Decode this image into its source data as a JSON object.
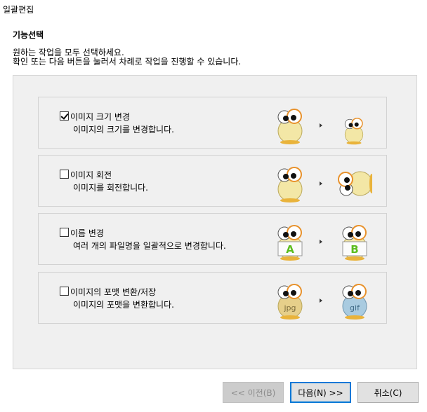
{
  "window": {
    "title": "일괄편집"
  },
  "header": {
    "section_title": "기능선택",
    "desc_line1": "원하는 작업을 모두 선택하세요.",
    "desc_line2": "확인 또는 다음 버튼을 눌러서 차례로 작업을 진행할 수 있습니다."
  },
  "options": [
    {
      "title": "이미지 크기 변경",
      "subtitle": "이미지의 크기를 변경합니다.",
      "checked": true,
      "icon_left": "mascot-large-icon",
      "icon_right": "mascot-small-icon"
    },
    {
      "title": "이미지 회전",
      "subtitle": "이미지를 회전합니다.",
      "checked": false,
      "icon_left": "mascot-icon",
      "icon_right": "mascot-rotated-icon"
    },
    {
      "title": "이름 변경",
      "subtitle": "여러 개의 파일명을 일괄적으로 변경합니다.",
      "checked": false,
      "icon_left": "mascot-sign-a-icon",
      "icon_right": "mascot-sign-b-icon",
      "sign_left": "A",
      "sign_right": "B"
    },
    {
      "title": "이미지의 포맷 변환/저장",
      "subtitle": "이미지의 포맷을 변환합니다.",
      "checked": false,
      "icon_left": "mascot-jpg-icon",
      "icon_right": "mascot-gif-icon",
      "sign_left": "jpg",
      "sign_right": "gif"
    }
  ],
  "buttons": {
    "prev": "<< 이전(B)",
    "next": "다음(N) >>",
    "cancel": "취소(C)"
  },
  "colors": {
    "focus_accent": "#0078d7",
    "mascot_body": "#f3e7a6",
    "mascot_ring": "#e8912b"
  }
}
